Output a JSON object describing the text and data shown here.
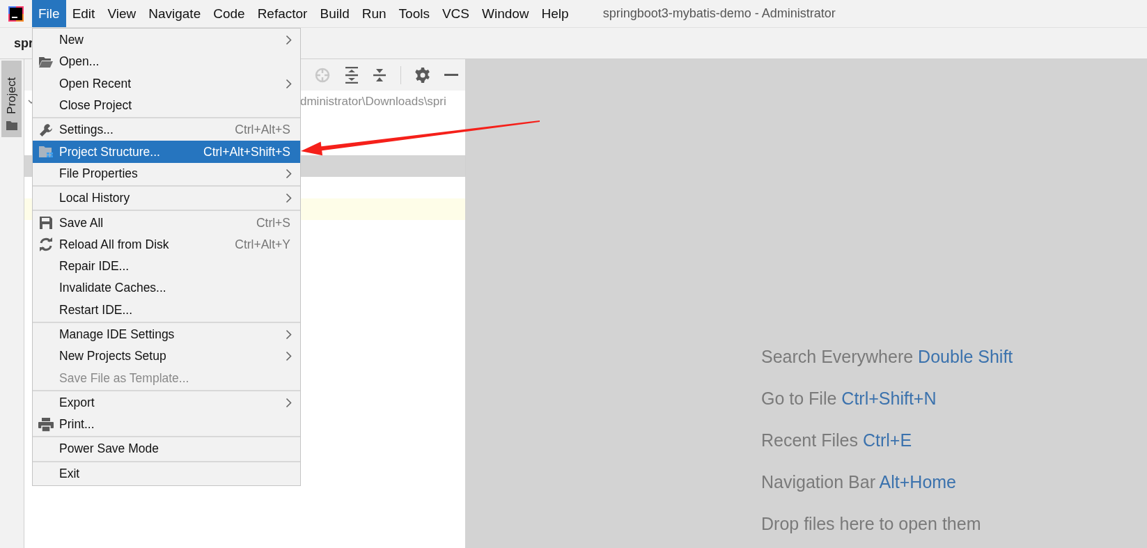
{
  "menubar": {
    "items": [
      {
        "label": "File",
        "selected": true
      },
      {
        "label": "Edit",
        "selected": false
      },
      {
        "label": "View",
        "selected": false
      },
      {
        "label": "Navigate",
        "selected": false
      },
      {
        "label": "Code",
        "selected": false
      },
      {
        "label": "Refactor",
        "selected": false
      },
      {
        "label": "Build",
        "selected": false
      },
      {
        "label": "Run",
        "selected": false
      },
      {
        "label": "Tools",
        "selected": false
      },
      {
        "label": "VCS",
        "selected": false
      },
      {
        "label": "Window",
        "selected": false
      },
      {
        "label": "Help",
        "selected": false
      }
    ]
  },
  "window": {
    "title": "springboot3-mybatis-demo - Administrator"
  },
  "navbar": {
    "breadcrumb": "spr"
  },
  "tool_strip": {
    "tabs": [
      {
        "label": "Project",
        "selected": true
      }
    ]
  },
  "project_panel": {
    "rows": [
      {
        "kind": "path",
        "text": "dministrator\\Downloads\\spri",
        "expanded": true
      },
      {
        "kind": "plain"
      },
      {
        "kind": "plain"
      },
      {
        "kind": "selected"
      },
      {
        "kind": "plain"
      },
      {
        "kind": "caret_line"
      }
    ]
  },
  "file_menu": {
    "groups": [
      {
        "items": [
          {
            "label": "New",
            "submenu": true,
            "selected": false,
            "disabled": false
          },
          {
            "label": "Open...",
            "kind": "open",
            "submenu": false,
            "selected": false,
            "disabled": false
          },
          {
            "label": "Open Recent",
            "submenu": true,
            "selected": false,
            "disabled": false
          },
          {
            "label": "Close Project",
            "submenu": false,
            "selected": false,
            "disabled": false
          }
        ]
      },
      {
        "items": [
          {
            "label": "Settings...",
            "kind": "settings",
            "shortcut": "Ctrl+Alt+S",
            "submenu": false,
            "selected": false,
            "disabled": false
          },
          {
            "label": "Project Structure...",
            "kind": "structure",
            "shortcut": "Ctrl+Alt+Shift+S",
            "submenu": false,
            "selected": true,
            "disabled": false
          },
          {
            "label": "File Properties",
            "submenu": true,
            "selected": false,
            "disabled": false
          }
        ]
      },
      {
        "items": [
          {
            "label": "Local History",
            "submenu": true,
            "selected": false,
            "disabled": false
          }
        ]
      },
      {
        "items": [
          {
            "label": "Save All",
            "kind": "save",
            "shortcut": "Ctrl+S",
            "submenu": false,
            "selected": false,
            "disabled": false
          },
          {
            "label": "Reload All from Disk",
            "kind": "reload",
            "shortcut": "Ctrl+Alt+Y",
            "submenu": false,
            "selected": false,
            "disabled": false
          },
          {
            "label": "Repair IDE...",
            "submenu": false,
            "selected": false,
            "disabled": false
          },
          {
            "label": "Invalidate Caches...",
            "submenu": false,
            "selected": false,
            "disabled": false
          },
          {
            "label": "Restart IDE...",
            "submenu": false,
            "selected": false,
            "disabled": false
          }
        ]
      },
      {
        "items": [
          {
            "label": "Manage IDE Settings",
            "submenu": true,
            "selected": false,
            "disabled": false
          },
          {
            "label": "New Projects Setup",
            "submenu": true,
            "selected": false,
            "disabled": false
          },
          {
            "label": "Save File as Template...",
            "submenu": false,
            "selected": false,
            "disabled": true
          }
        ]
      },
      {
        "items": [
          {
            "label": "Export",
            "submenu": true,
            "selected": false,
            "disabled": false
          },
          {
            "label": "Print...",
            "kind": "print",
            "submenu": false,
            "selected": false,
            "disabled": false
          }
        ]
      },
      {
        "items": [
          {
            "label": "Power Save Mode",
            "submenu": false,
            "selected": false,
            "disabled": false
          }
        ]
      },
      {
        "items": [
          {
            "label": "Exit",
            "submenu": false,
            "selected": false,
            "disabled": false
          }
        ]
      }
    ]
  },
  "editor": {
    "hints": [
      {
        "text": "Search Everywhere",
        "shortcut": "Double Shift"
      },
      {
        "text": "Go to File",
        "shortcut": "Ctrl+Shift+N"
      },
      {
        "text": "Recent Files",
        "shortcut": "Ctrl+E"
      },
      {
        "text": "Navigation Bar",
        "shortcut": "Alt+Home"
      },
      {
        "text": "Drop files here to open them"
      }
    ]
  },
  "annotation": {
    "kind": "arrow"
  }
}
